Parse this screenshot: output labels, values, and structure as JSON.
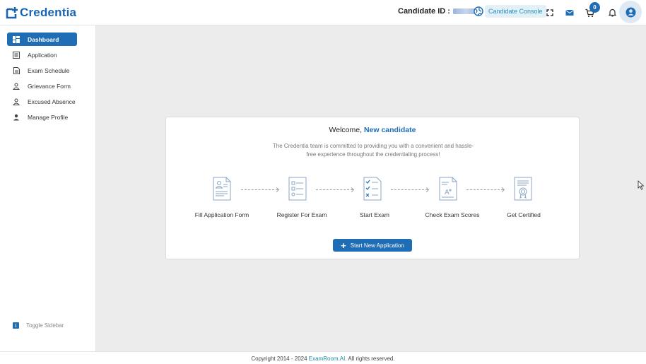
{
  "header": {
    "logo_text": "Credentia",
    "candidate_id_label": "Candidate ID :",
    "console_label": "Candidate Console",
    "cart_count": "0"
  },
  "sidebar": {
    "items": [
      {
        "label": "Dashboard",
        "icon": "dashboard-icon",
        "active": true
      },
      {
        "label": "Application",
        "icon": "list-icon",
        "active": false
      },
      {
        "label": "Exam Schedule",
        "icon": "document-icon",
        "active": false
      },
      {
        "label": "Grievance Form",
        "icon": "person-form-icon",
        "active": false
      },
      {
        "label": "Excused Absence",
        "icon": "person-form-icon",
        "active": false
      },
      {
        "label": "Manage Profile",
        "icon": "person-icon",
        "active": false
      }
    ],
    "toggle_label": "Toggle Sidebar"
  },
  "main": {
    "welcome_prefix": "Welcome,",
    "welcome_name": "New candidate",
    "subtext": "The Credentia team is committed to providing you with a convenient and hassle-free experience throughout the credentialing process!",
    "steps": [
      {
        "label": "Fill Application Form",
        "icon": "application-form-icon"
      },
      {
        "label": "Register For Exam",
        "icon": "register-checklist-icon"
      },
      {
        "label": "Start Exam",
        "icon": "exam-sheet-icon"
      },
      {
        "label": "Check Exam Scores",
        "icon": "score-sheet-icon"
      },
      {
        "label": "Get Certified",
        "icon": "certificate-icon"
      }
    ],
    "start_button_label": "Start New Application"
  },
  "footer": {
    "prefix": "Copyright 2014 - 2024",
    "link": "ExamRoom.AI.",
    "suffix": "All rights reserved."
  },
  "colors": {
    "primary": "#1f6db5",
    "background": "#ececec",
    "console_bg": "#e3f1f6"
  }
}
